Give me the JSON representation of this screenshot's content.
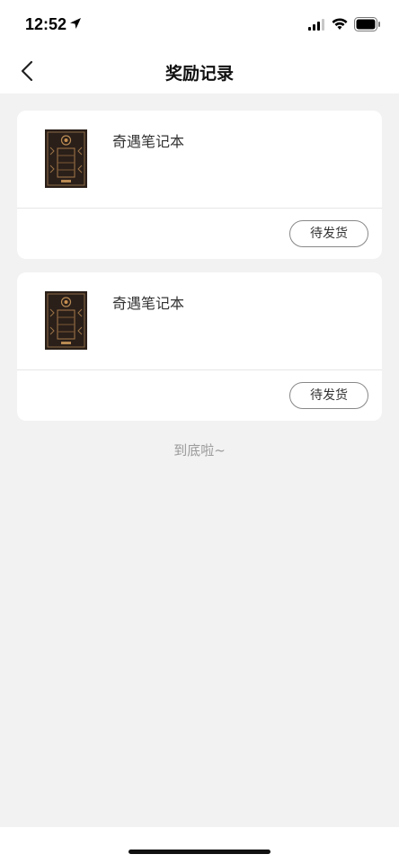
{
  "status_bar": {
    "time": "12:52",
    "icons": [
      "location-arrow-icon",
      "cellular-signal-icon",
      "wifi-icon",
      "battery-icon"
    ]
  },
  "nav": {
    "title": "奖励记录",
    "back_icon": "chevron-left-icon"
  },
  "rewards": [
    {
      "name": "奇遇笔记本",
      "status_button": "待发货",
      "thumb_icon": "notebook-cover-image"
    },
    {
      "name": "奇遇笔记本",
      "status_button": "待发货",
      "thumb_icon": "notebook-cover-image"
    }
  ],
  "footer_text": "到底啦~",
  "colors": {
    "page_background": "#f2f2f2",
    "card_background": "#ffffff",
    "muted_text": "#9a9a9a",
    "button_border": "#888888"
  }
}
